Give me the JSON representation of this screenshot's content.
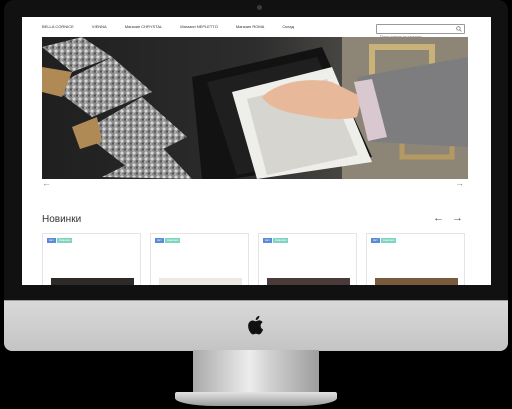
{
  "nav": {
    "items": [
      "BELLA CORNICE",
      "VIENNA",
      "Магазин CHRYSTAL",
      "Магазин NEPLETTO",
      "Магазин ROMA",
      "Склад"
    ]
  },
  "search": {
    "placeholder": "Поиск товара по каталогу"
  },
  "hero": {
    "prev_icon": "arrow-left",
    "next_icon": "arrow-right"
  },
  "section": {
    "title": "Новинки"
  },
  "products": [
    {
      "badges": [
        "Акт",
        "Новинки"
      ],
      "frame_color": "#2e2a27"
    },
    {
      "badges": [
        "Акт",
        "Новинки"
      ],
      "frame_color": "#ece9e4"
    },
    {
      "badges": [
        "Акт",
        "Новинки"
      ],
      "frame_color": "#4a3a3a"
    },
    {
      "badges": [
        "Акт",
        "Новинки"
      ],
      "frame_color": "#7a5a3c"
    }
  ],
  "colors": {
    "badge_new": "#5b8bd6",
    "badge_promo": "#7fd3c1",
    "bezel": "#111111",
    "chin": "#d0d0d0"
  }
}
